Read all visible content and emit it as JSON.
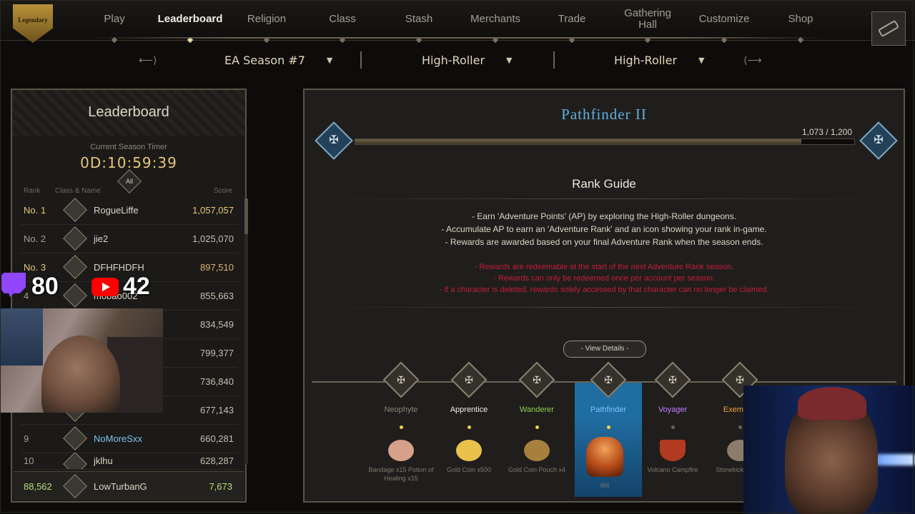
{
  "logo": {
    "text": "Legendary"
  },
  "nav": {
    "items": [
      {
        "label": "Play"
      },
      {
        "label": "Leaderboard",
        "active": true
      },
      {
        "label": "Religion"
      },
      {
        "label": "Class"
      },
      {
        "label": "Stash"
      },
      {
        "label": "Merchants"
      },
      {
        "label": "Trade"
      },
      {
        "label": "Gathering Hall"
      },
      {
        "label": "Customize"
      },
      {
        "label": "Shop"
      }
    ],
    "settings_icon": "wrench-icon"
  },
  "filters": {
    "season": "EA Season #7",
    "mode": "High-Roller",
    "category": "High-Roller"
  },
  "leaderboard": {
    "title": "Leaderboard",
    "timer_label": "Current Season Timer",
    "timer": "0D:10:59:39",
    "filter_all": "All",
    "col_rank": "Rank",
    "col_class": "Class & Name",
    "col_score": "Score",
    "rows": [
      {
        "rank": "No. 1",
        "name": "RogueLiffe",
        "score": "1,057,057"
      },
      {
        "rank": "No. 2",
        "name": "jie2",
        "score": "1,025,070"
      },
      {
        "rank": "No. 3",
        "name": "DFHFHDFH",
        "score": "897,510"
      },
      {
        "rank": "4",
        "name": "mobao002",
        "score": "855,663"
      },
      {
        "rank": "",
        "name": "",
        "score": "834,549"
      },
      {
        "rank": "",
        "name": "",
        "score": "799,377"
      },
      {
        "rank": "",
        "name": "",
        "score": "736,840"
      },
      {
        "rank": "",
        "name": "",
        "score": "677,143"
      },
      {
        "rank": "9",
        "name": "NoMoreSxx",
        "score": "660,281"
      },
      {
        "rank": "10",
        "name": "jklhu",
        "score": "628,287"
      }
    ],
    "me": {
      "rank": "88,562",
      "name": "LowTurbanG",
      "score": "7,673"
    }
  },
  "stream": {
    "twitch_count": "80",
    "youtube_count": "42"
  },
  "rank_panel": {
    "title": "Pathfinder II",
    "progress_text": "1,073 / 1,200",
    "progress": 0.894,
    "guide_title": "Rank Guide",
    "guide_lines": [
      "- Earn 'Adventure Points' (AP) by exploring the High-Roller dungeons.",
      "- Accumulate AP to earn an 'Adventure Rank' and an icon showing your rank in-game.",
      "- Rewards are awarded based on your final Adventure Rank when the season ends."
    ],
    "warnings": [
      "- Rewards are redeemable at the start of the next Adventure Rank season.",
      "- Rewards can only be redeemed once per account per season.",
      "- If a character is deleted, rewards solely accessed by that character can no longer be claimed."
    ],
    "details_button": "- View Details -",
    "tiers": [
      {
        "label": "Neophyte",
        "color": "#8a8476"
      },
      {
        "label": "Apprentice",
        "color": "#f2efe8"
      },
      {
        "label": "Wanderer",
        "color": "#8fd14f"
      },
      {
        "label": "Pathfinder",
        "color": "#7ec4ff",
        "active": true
      },
      {
        "label": "Voyager",
        "color": "#c77dff"
      },
      {
        "label": "Exemplar",
        "color": "#f2a23a"
      }
    ],
    "rewards": [
      {
        "name": "Bandage x15 Potion of Healing x15",
        "color": "#d7a08a"
      },
      {
        "name": "Gold Coin x500",
        "color": "#e8c24a"
      },
      {
        "name": "Gold Coin Pouch x4",
        "color": "#a7803e"
      },
      {
        "name": "Ifrit",
        "color": "#e07a2a"
      },
      {
        "name": "Volcano Campfire",
        "color": "#b23a22"
      },
      {
        "name": "Stonekick Dance",
        "color": "#8d7c6c"
      }
    ]
  }
}
